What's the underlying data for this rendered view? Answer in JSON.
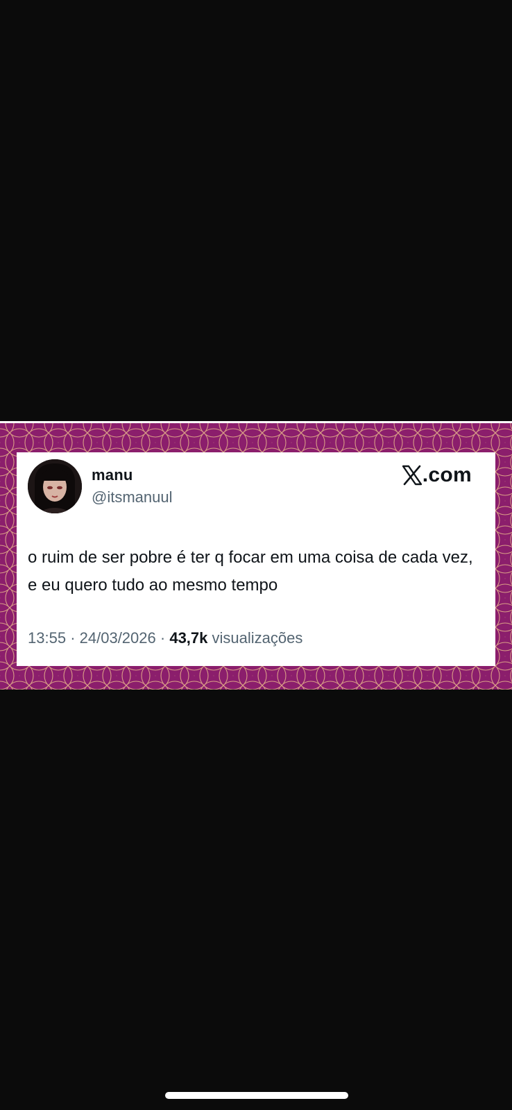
{
  "tweet": {
    "display_name": "manu",
    "handle": "@itsmanuul",
    "brand": "X.com",
    "text": "o ruim de ser pobre é ter q focar em uma coisa de cada vez, e eu quero tudo ao mesmo tempo",
    "time": "13:55",
    "date": "24/03/2026",
    "separator": "·",
    "views_count": "43,7k",
    "views_label": "visualizações"
  },
  "icons": {
    "brand": "x-logo-icon",
    "avatar": "avatar"
  },
  "colors": {
    "background": "#0b0b0b",
    "frame": "#8b1e6c",
    "pattern_line": "#e7b58a",
    "card": "#ffffff",
    "text_primary": "#0f1419",
    "text_secondary": "#536471"
  }
}
